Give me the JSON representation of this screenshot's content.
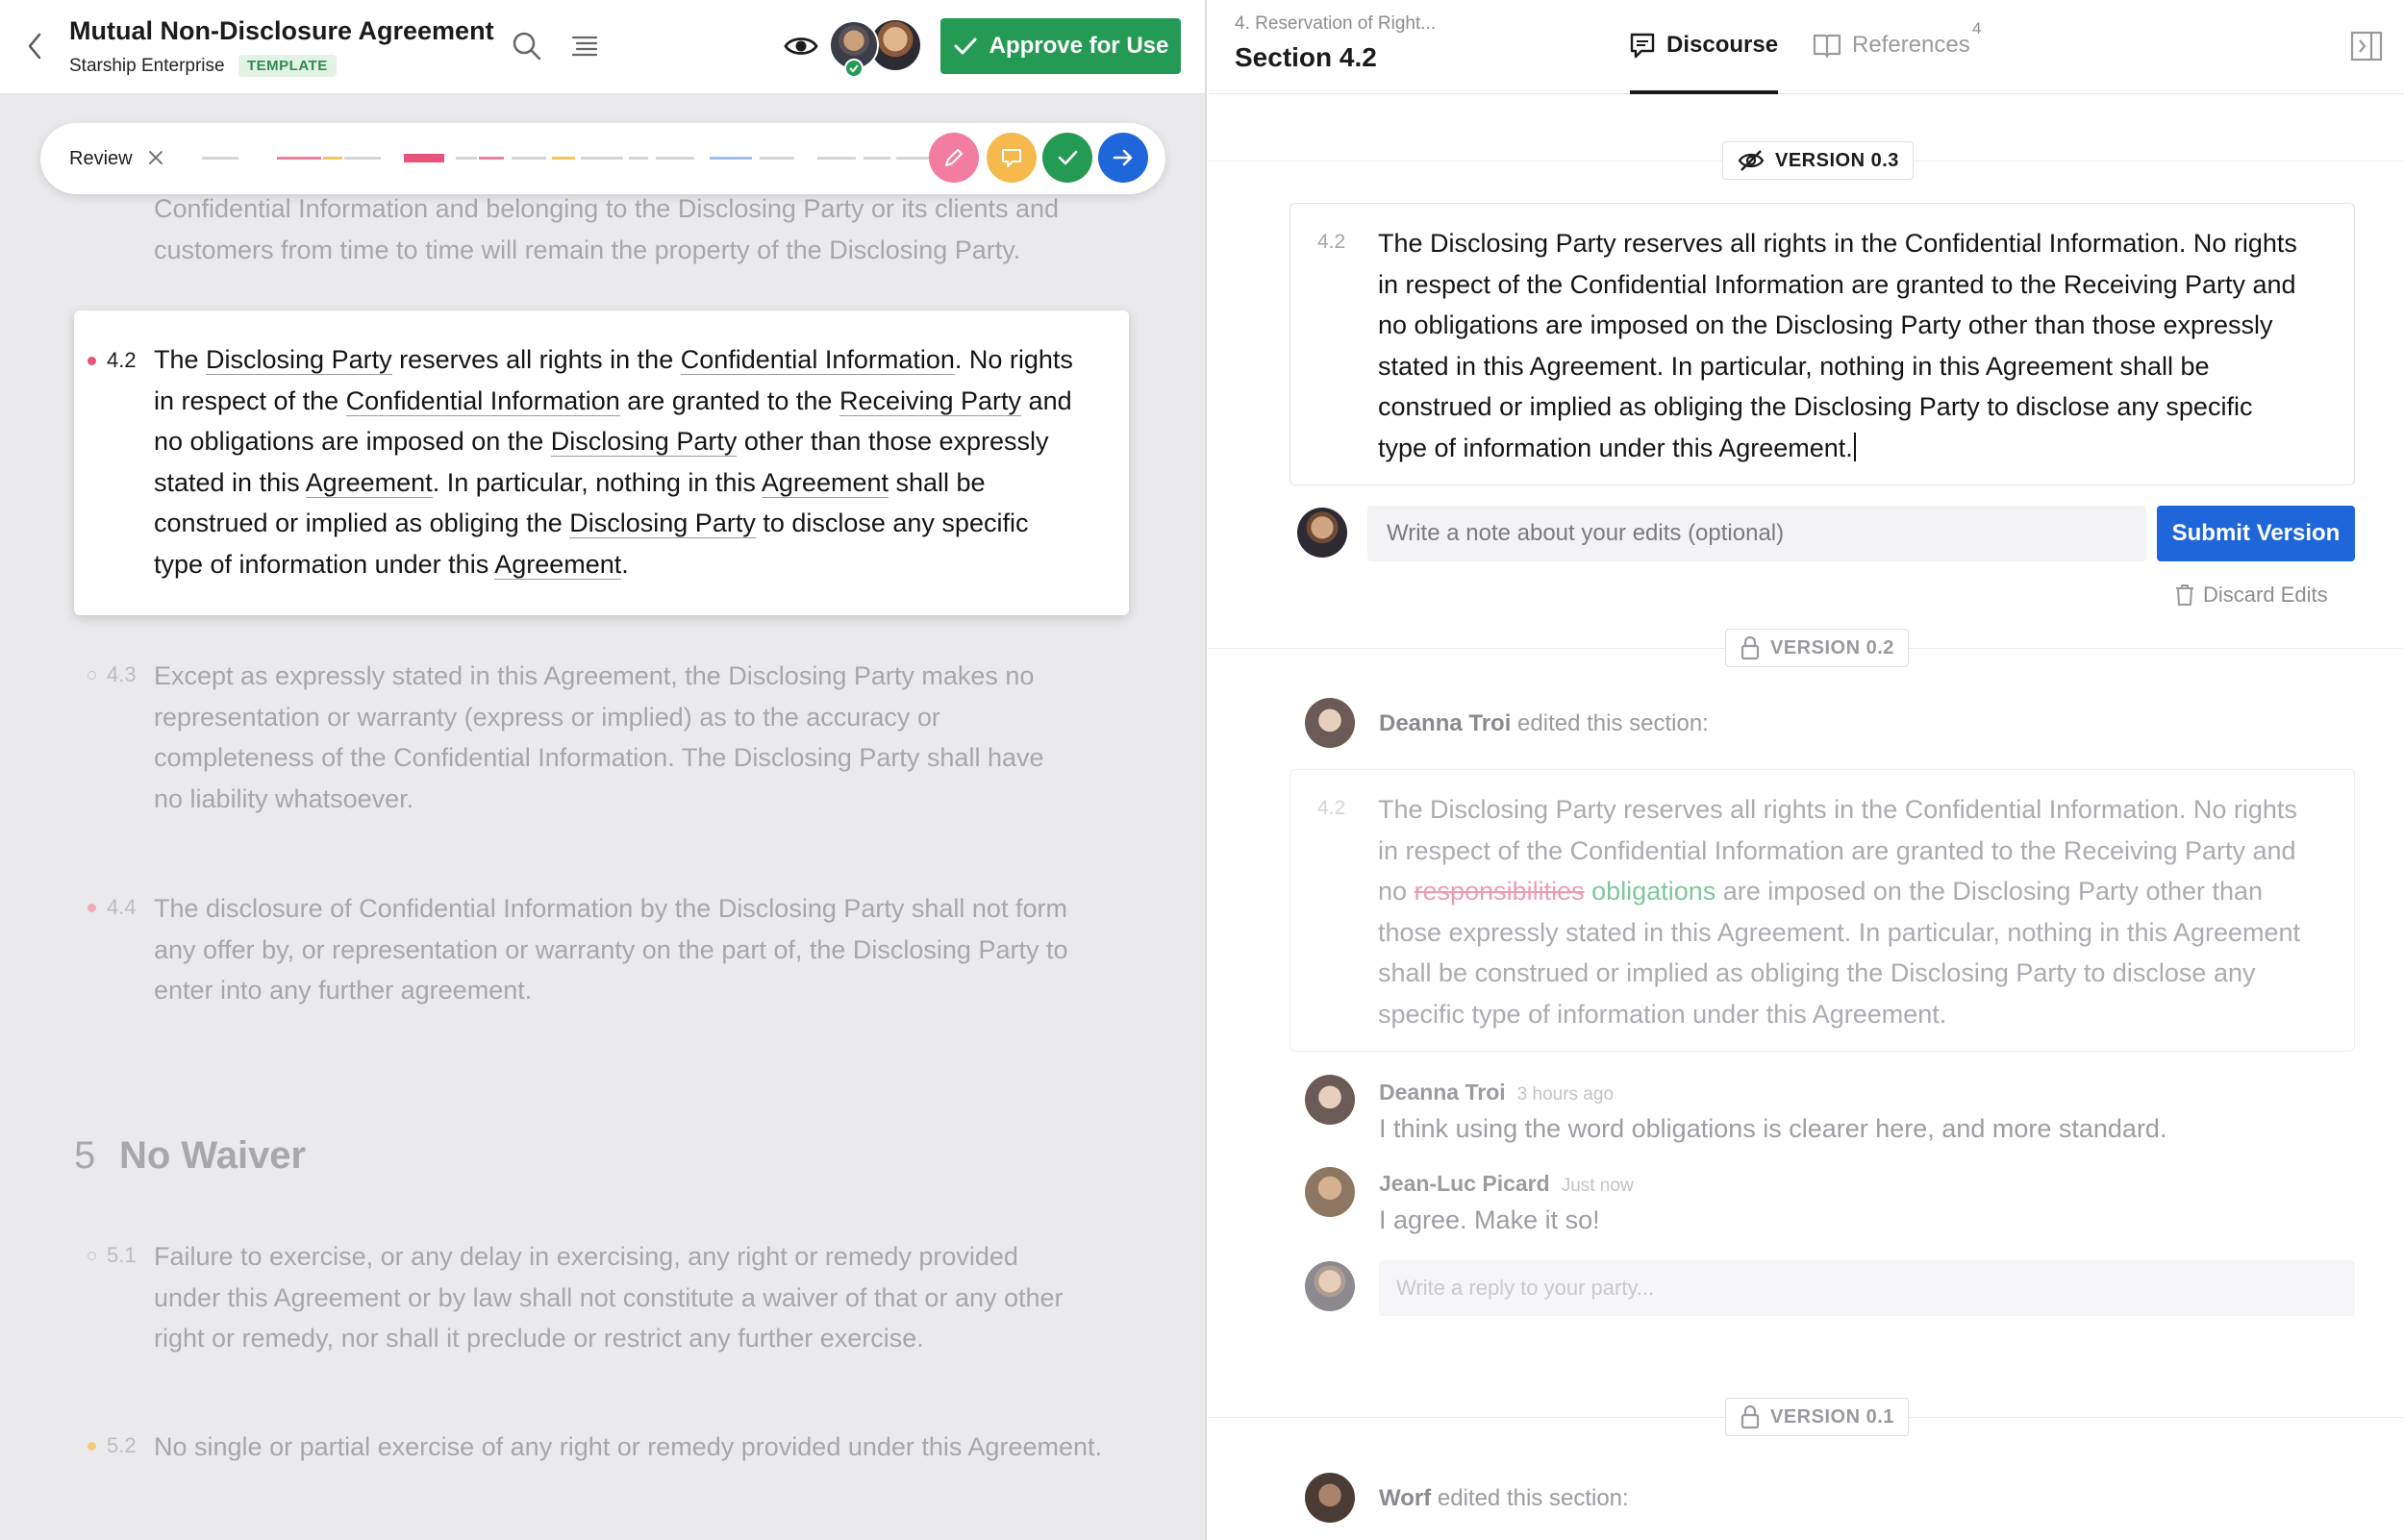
{
  "header": {
    "title": "Mutual Non-Disclosure Agreement",
    "org": "Starship Enterprise",
    "tag": "TEMPLATE",
    "approve_label": "Approve for Use"
  },
  "review": {
    "label": "Review",
    "colors": {
      "pink": "#f27da0",
      "amber": "#f5b94e",
      "green": "#259a55",
      "blue": "#1f66db"
    }
  },
  "document": {
    "prev_tail": [
      "Confidential Information and belonging to the Disclosing Party or its clients and",
      "customers from time to time will remain the property of the Disclosing Party."
    ],
    "active": {
      "number": "4.2",
      "lines": [
        [
          "The ",
          "Disclosing Party",
          " reserves all rights in the ",
          "Confidential Information",
          ". No rights"
        ],
        [
          "in respect of the ",
          "Confidential Information",
          " are granted to the ",
          "Receiving Party",
          " and"
        ],
        [
          "no obligations are imposed on the ",
          "Disclosing Party",
          " other than those expressly"
        ],
        [
          "stated in this ",
          "Agreement",
          ". In particular, nothing in this ",
          "Agreement",
          " shall be"
        ],
        [
          "construed or implied as obliging the ",
          "Disclosing Party",
          " to disclose any specific"
        ],
        [
          "type of information under this ",
          "Agreement",
          "."
        ]
      ]
    },
    "p43": {
      "number": "4.3",
      "lines": [
        "Except as expressly stated in this Agreement, the Disclosing Party makes no",
        "representation or warranty (express or implied) as to the accuracy or",
        "completeness of the Confidential Information. The Disclosing Party shall have",
        "no liability whatsoever."
      ]
    },
    "p44": {
      "number": "4.4",
      "lines": [
        "The disclosure of Confidential Information by the Disclosing Party shall not form",
        "any offer by, or representation or warranty on the part of, the Disclosing Party to",
        "enter into any further agreement."
      ]
    },
    "section5": {
      "number": "5",
      "title": "No Waiver"
    },
    "p51": {
      "number": "5.1",
      "lines": [
        "Failure to exercise, or any delay in exercising, any right or remedy provided",
        "under this Agreement or by law shall not constitute a waiver of that or any other",
        "right or remedy, nor shall it preclude or restrict any further exercise."
      ]
    },
    "p52": {
      "number": "5.2",
      "lines": [
        "No single or partial exercise of any right or remedy provided under this Agreement."
      ]
    }
  },
  "panel": {
    "breadcrumb": "4. Reservation of Right...",
    "section": "Section 4.2",
    "tab_discourse": "Discourse",
    "tab_references": "References",
    "references_count": "4",
    "version_current": "VERSION 0.3",
    "editor_number": "4.2",
    "editor_lines": [
      "The Disclosing Party reserves all rights in the Confidential Information. No rights",
      "in respect of the Confidential Information are granted to the Receiving Party and",
      "no obligations are imposed on the Disclosing Party other than those expressly",
      "stated in this Agreement. In particular, nothing in this Agreement shall be",
      "construed or implied as obliging the Disclosing Party to disclose any specific",
      "type of information under this Agreement."
    ],
    "note_placeholder": "Write a note about your edits (optional)",
    "submit_label": "Submit Version",
    "discard_label": "Discard Edits",
    "version_02": "VERSION 0.2",
    "edit_author_02": "Deanna Troi",
    "edited_text": "edited this section:",
    "old_number": "4.2",
    "old_lines": {
      "l1": "The Disclosing Party reserves all rights in the Confidential Information. No rights",
      "l2": "in respect of the Confidential Information are granted to the Receiving Party and",
      "l3_a": "no ",
      "l3_del": "responsibilities",
      "l3_ins": "obligations",
      "l3_b": " are imposed on the Disclosing Party other than",
      "l4": "those expressly stated in this Agreement. In particular, nothing in this Agreement",
      "l5": "shall be construed or implied as obliging the Disclosing Party to disclose any",
      "l6": "specific type of information under this Agreement."
    },
    "comments": [
      {
        "name": "Deanna Troi",
        "time": "3 hours ago",
        "text": "I think using the word obligations is clearer here, and more standard."
      },
      {
        "name": "Jean-Luc Picard",
        "time": "Just now",
        "text": "I agree. Make it so!"
      }
    ],
    "reply_placeholder": "Write a reply to your party...",
    "version_01": "VERSION 0.1",
    "edit_author_01": "Worf"
  }
}
